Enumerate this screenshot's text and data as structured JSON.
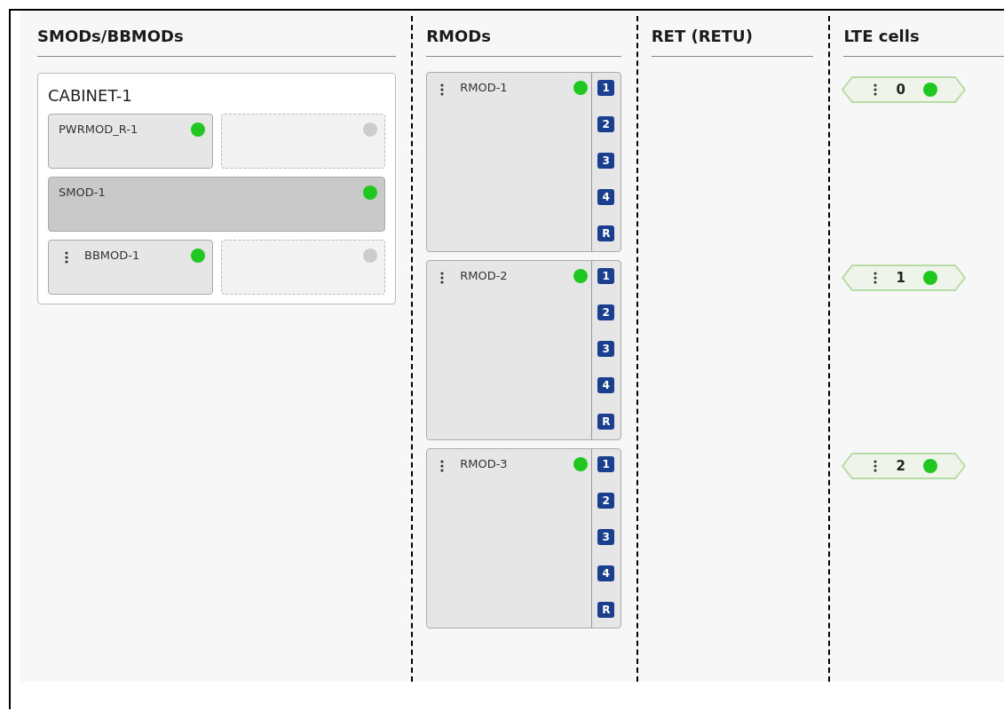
{
  "smods": {
    "title": "SMODs/BBMODs",
    "cabinets": [
      {
        "title": "CABINET-1",
        "rows": [
          [
            {
              "kind": "module",
              "name": "PWRMOD_R-1",
              "menu": false,
              "on": true
            },
            {
              "kind": "empty",
              "on": false
            }
          ],
          [
            {
              "kind": "wide",
              "name": "SMOD-1",
              "menu": false,
              "on": true
            }
          ],
          [
            {
              "kind": "module",
              "name": "BBMOD-1",
              "menu": true,
              "on": true
            },
            {
              "kind": "empty",
              "on": false
            }
          ]
        ]
      }
    ]
  },
  "rmods": {
    "title": "RMODs",
    "items": [
      {
        "name": "RMOD-1",
        "menu": true,
        "on": true,
        "ports": [
          "1",
          "2",
          "3",
          "4",
          "R"
        ]
      },
      {
        "name": "RMOD-2",
        "menu": true,
        "on": true,
        "ports": [
          "1",
          "2",
          "3",
          "4",
          "R"
        ]
      },
      {
        "name": "RMOD-3",
        "menu": true,
        "on": true,
        "ports": [
          "1",
          "2",
          "3",
          "4",
          "R"
        ]
      }
    ]
  },
  "ret": {
    "title": "RET (RETU)"
  },
  "lte_cells": {
    "title": "LTE cells",
    "items": [
      {
        "label": "0",
        "menu": true,
        "on": true
      },
      {
        "label": "1",
        "menu": true,
        "on": true
      },
      {
        "label": "2",
        "menu": true,
        "on": true
      }
    ]
  }
}
